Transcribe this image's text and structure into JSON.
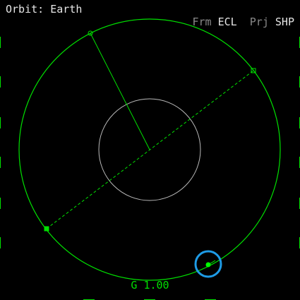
{
  "mfd": {
    "title": "Orbit: Earth",
    "frame_label": "Frm",
    "frame_value": "ECL",
    "projection_label": "Prj",
    "projection_value": "SHP",
    "footer": "G 1.00"
  },
  "colors": {
    "background": "#000000",
    "orbit": "#00e000",
    "orbit_bright": "#00ff00",
    "planet": "#bbbbbb",
    "text_primary": "#e6e6e6",
    "text_dim": "#8a8a8a",
    "highlight": "#1e9be6"
  }
}
